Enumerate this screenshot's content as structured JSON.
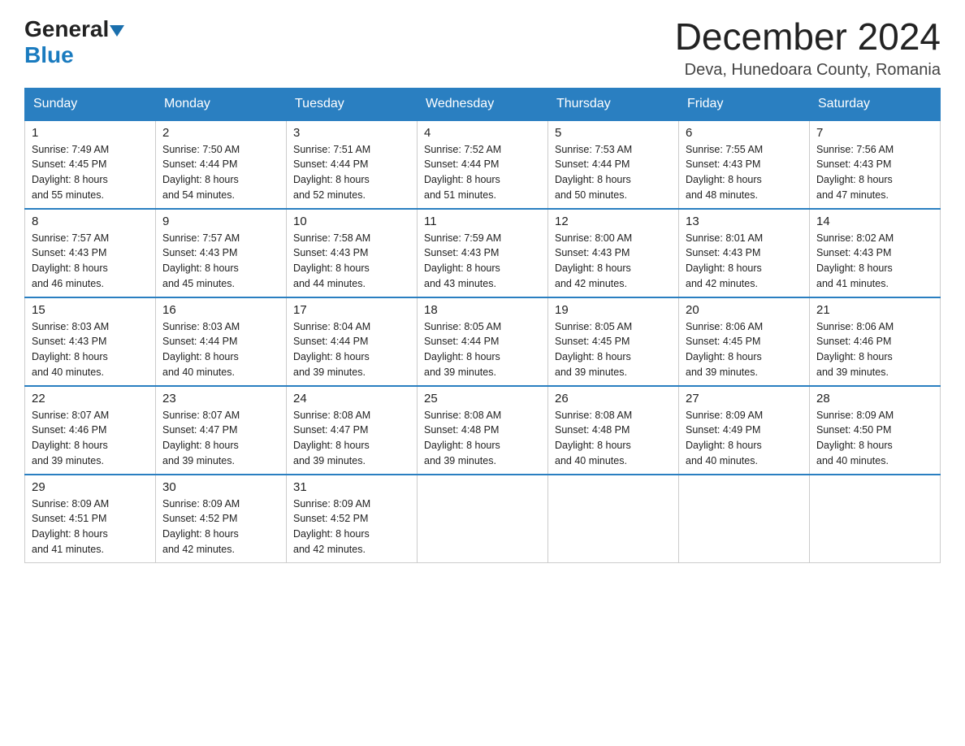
{
  "header": {
    "logo_general": "General",
    "logo_blue": "Blue",
    "month_title": "December 2024",
    "location": "Deva, Hunedoara County, Romania"
  },
  "weekdays": [
    "Sunday",
    "Monday",
    "Tuesday",
    "Wednesday",
    "Thursday",
    "Friday",
    "Saturday"
  ],
  "weeks": [
    [
      {
        "day": "1",
        "sunrise": "7:49 AM",
        "sunset": "4:45 PM",
        "daylight": "8 hours and 55 minutes."
      },
      {
        "day": "2",
        "sunrise": "7:50 AM",
        "sunset": "4:44 PM",
        "daylight": "8 hours and 54 minutes."
      },
      {
        "day": "3",
        "sunrise": "7:51 AM",
        "sunset": "4:44 PM",
        "daylight": "8 hours and 52 minutes."
      },
      {
        "day": "4",
        "sunrise": "7:52 AM",
        "sunset": "4:44 PM",
        "daylight": "8 hours and 51 minutes."
      },
      {
        "day": "5",
        "sunrise": "7:53 AM",
        "sunset": "4:44 PM",
        "daylight": "8 hours and 50 minutes."
      },
      {
        "day": "6",
        "sunrise": "7:55 AM",
        "sunset": "4:43 PM",
        "daylight": "8 hours and 48 minutes."
      },
      {
        "day": "7",
        "sunrise": "7:56 AM",
        "sunset": "4:43 PM",
        "daylight": "8 hours and 47 minutes."
      }
    ],
    [
      {
        "day": "8",
        "sunrise": "7:57 AM",
        "sunset": "4:43 PM",
        "daylight": "8 hours and 46 minutes."
      },
      {
        "day": "9",
        "sunrise": "7:57 AM",
        "sunset": "4:43 PM",
        "daylight": "8 hours and 45 minutes."
      },
      {
        "day": "10",
        "sunrise": "7:58 AM",
        "sunset": "4:43 PM",
        "daylight": "8 hours and 44 minutes."
      },
      {
        "day": "11",
        "sunrise": "7:59 AM",
        "sunset": "4:43 PM",
        "daylight": "8 hours and 43 minutes."
      },
      {
        "day": "12",
        "sunrise": "8:00 AM",
        "sunset": "4:43 PM",
        "daylight": "8 hours and 42 minutes."
      },
      {
        "day": "13",
        "sunrise": "8:01 AM",
        "sunset": "4:43 PM",
        "daylight": "8 hours and 42 minutes."
      },
      {
        "day": "14",
        "sunrise": "8:02 AM",
        "sunset": "4:43 PM",
        "daylight": "8 hours and 41 minutes."
      }
    ],
    [
      {
        "day": "15",
        "sunrise": "8:03 AM",
        "sunset": "4:43 PM",
        "daylight": "8 hours and 40 minutes."
      },
      {
        "day": "16",
        "sunrise": "8:03 AM",
        "sunset": "4:44 PM",
        "daylight": "8 hours and 40 minutes."
      },
      {
        "day": "17",
        "sunrise": "8:04 AM",
        "sunset": "4:44 PM",
        "daylight": "8 hours and 39 minutes."
      },
      {
        "day": "18",
        "sunrise": "8:05 AM",
        "sunset": "4:44 PM",
        "daylight": "8 hours and 39 minutes."
      },
      {
        "day": "19",
        "sunrise": "8:05 AM",
        "sunset": "4:45 PM",
        "daylight": "8 hours and 39 minutes."
      },
      {
        "day": "20",
        "sunrise": "8:06 AM",
        "sunset": "4:45 PM",
        "daylight": "8 hours and 39 minutes."
      },
      {
        "day": "21",
        "sunrise": "8:06 AM",
        "sunset": "4:46 PM",
        "daylight": "8 hours and 39 minutes."
      }
    ],
    [
      {
        "day": "22",
        "sunrise": "8:07 AM",
        "sunset": "4:46 PM",
        "daylight": "8 hours and 39 minutes."
      },
      {
        "day": "23",
        "sunrise": "8:07 AM",
        "sunset": "4:47 PM",
        "daylight": "8 hours and 39 minutes."
      },
      {
        "day": "24",
        "sunrise": "8:08 AM",
        "sunset": "4:47 PM",
        "daylight": "8 hours and 39 minutes."
      },
      {
        "day": "25",
        "sunrise": "8:08 AM",
        "sunset": "4:48 PM",
        "daylight": "8 hours and 39 minutes."
      },
      {
        "day": "26",
        "sunrise": "8:08 AM",
        "sunset": "4:48 PM",
        "daylight": "8 hours and 40 minutes."
      },
      {
        "day": "27",
        "sunrise": "8:09 AM",
        "sunset": "4:49 PM",
        "daylight": "8 hours and 40 minutes."
      },
      {
        "day": "28",
        "sunrise": "8:09 AM",
        "sunset": "4:50 PM",
        "daylight": "8 hours and 40 minutes."
      }
    ],
    [
      {
        "day": "29",
        "sunrise": "8:09 AM",
        "sunset": "4:51 PM",
        "daylight": "8 hours and 41 minutes."
      },
      {
        "day": "30",
        "sunrise": "8:09 AM",
        "sunset": "4:52 PM",
        "daylight": "8 hours and 42 minutes."
      },
      {
        "day": "31",
        "sunrise": "8:09 AM",
        "sunset": "4:52 PM",
        "daylight": "8 hours and 42 minutes."
      },
      null,
      null,
      null,
      null
    ]
  ],
  "labels": {
    "sunrise": "Sunrise:",
    "sunset": "Sunset:",
    "daylight": "Daylight:"
  }
}
